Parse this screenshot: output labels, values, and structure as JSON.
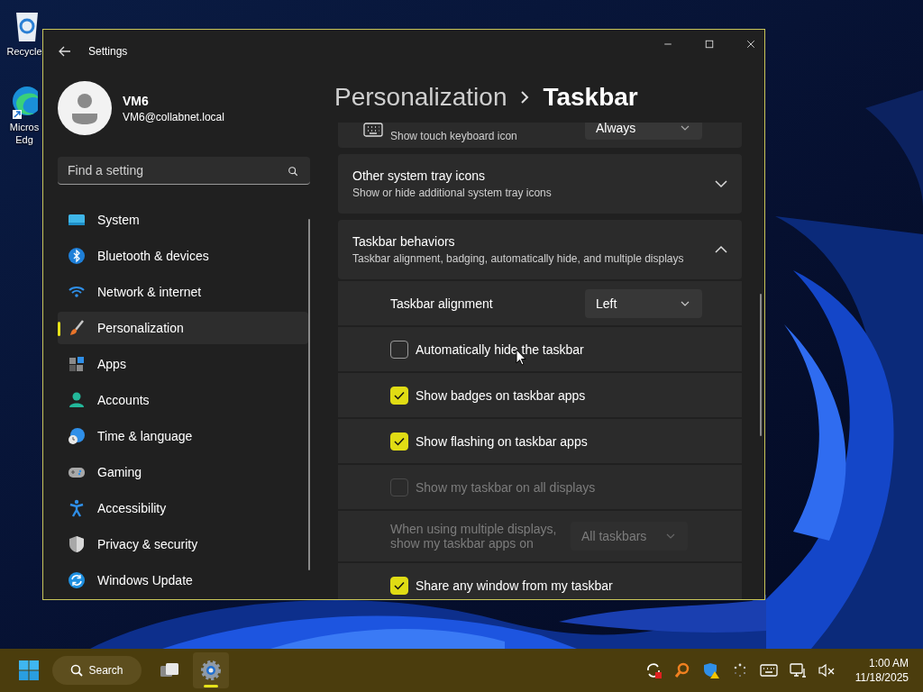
{
  "desktop": {
    "icons": [
      {
        "kind": "recycle-bin",
        "lines": [
          "Recycle"
        ]
      },
      {
        "kind": "browser",
        "lines": [
          "Micros",
          "Edg"
        ]
      }
    ]
  },
  "window": {
    "title": "Settings"
  },
  "account": {
    "name": "VM6",
    "email": "VM6@collabnet.local"
  },
  "search": {
    "placeholder": "Find a setting"
  },
  "sidebar": {
    "items": [
      {
        "kind": "system",
        "label": "System",
        "selected": false
      },
      {
        "kind": "bluetooth",
        "label": "Bluetooth & devices",
        "selected": false
      },
      {
        "kind": "network",
        "label": "Network & internet",
        "selected": false
      },
      {
        "kind": "personalization",
        "label": "Personalization",
        "selected": true
      },
      {
        "kind": "apps",
        "label": "Apps",
        "selected": false
      },
      {
        "kind": "accounts",
        "label": "Accounts",
        "selected": false
      },
      {
        "kind": "time",
        "label": "Time & language",
        "selected": false
      },
      {
        "kind": "gaming",
        "label": "Gaming",
        "selected": false
      },
      {
        "kind": "accessibility",
        "label": "Accessibility",
        "selected": false
      },
      {
        "kind": "privacy",
        "label": "Privacy & security",
        "selected": false
      },
      {
        "kind": "update",
        "label": "Windows Update",
        "selected": false
      }
    ]
  },
  "breadcrumb": [
    "Personalization",
    "Taskbar"
  ],
  "partial_card": {
    "subtitle": "Show touch keyboard icon",
    "dropdown": "Always"
  },
  "sections": [
    {
      "title": "Other system tray icons",
      "subtitle": "Show or hide additional system tray icons",
      "expanded": false
    },
    {
      "title": "Taskbar behaviors",
      "subtitle": "Taskbar alignment, badging, automatically hide, and multiple displays",
      "expanded": true,
      "rows": [
        {
          "kind": "dropdown",
          "label": "Taskbar alignment",
          "value": "Left",
          "disabled": false
        },
        {
          "kind": "checkbox",
          "label": "Automatically hide the taskbar",
          "checked": false,
          "disabled": false
        },
        {
          "kind": "checkbox",
          "label": "Show badges on taskbar apps",
          "checked": true,
          "disabled": false
        },
        {
          "kind": "checkbox",
          "label": "Show flashing on taskbar apps",
          "checked": true,
          "disabled": false
        },
        {
          "kind": "checkbox",
          "label": "Show my taskbar on all displays",
          "checked": false,
          "disabled": true
        },
        {
          "kind": "dropdown",
          "label": "When using multiple displays, show my taskbar apps on",
          "value": "All taskbars",
          "disabled": true
        },
        {
          "kind": "checkbox",
          "label": "Share any window from my taskbar",
          "checked": true,
          "disabled": false
        }
      ]
    }
  ],
  "taskbar": {
    "search_label": "Search",
    "apps": [
      {
        "kind": "task-view",
        "active": false
      },
      {
        "kind": "settings",
        "active": true
      }
    ],
    "time": "1:00 AM",
    "date": "11/18/2025"
  }
}
